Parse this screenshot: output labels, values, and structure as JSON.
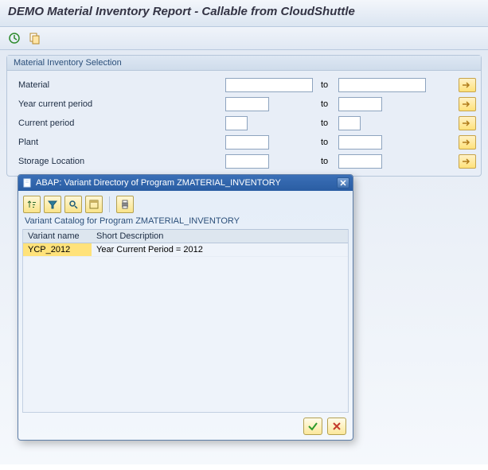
{
  "title": "DEMO Material Inventory Report - Callable from CloudShuttle",
  "toolbar": {
    "execute_icon": "execute",
    "variants_icon": "variants"
  },
  "selection": {
    "group_title": "Material Inventory Selection",
    "to_label": "to",
    "rows": [
      {
        "label": "Material",
        "from": "",
        "to": "",
        "size": "w110"
      },
      {
        "label": "Year current period",
        "from": "",
        "to": "",
        "size": "w55"
      },
      {
        "label": "Current period",
        "from": "",
        "to": "",
        "size": "w28"
      },
      {
        "label": "Plant",
        "from": "",
        "to": "",
        "size": "w55"
      },
      {
        "label": "Storage Location",
        "from": "",
        "to": "",
        "size": "w55"
      }
    ]
  },
  "dialog": {
    "title": "ABAP: Variant Directory of Program ZMATERIAL_INVENTORY",
    "heading": "Variant Catalog for Program ZMATERIAL_INVENTORY",
    "columns": [
      "Variant name",
      "Short Description"
    ],
    "rows": [
      {
        "name": "YCP_2012",
        "desc": "Year Current Period = 2012"
      }
    ],
    "toolbar_icons": [
      "sort-asc",
      "filter",
      "find",
      "layout",
      "print"
    ]
  }
}
